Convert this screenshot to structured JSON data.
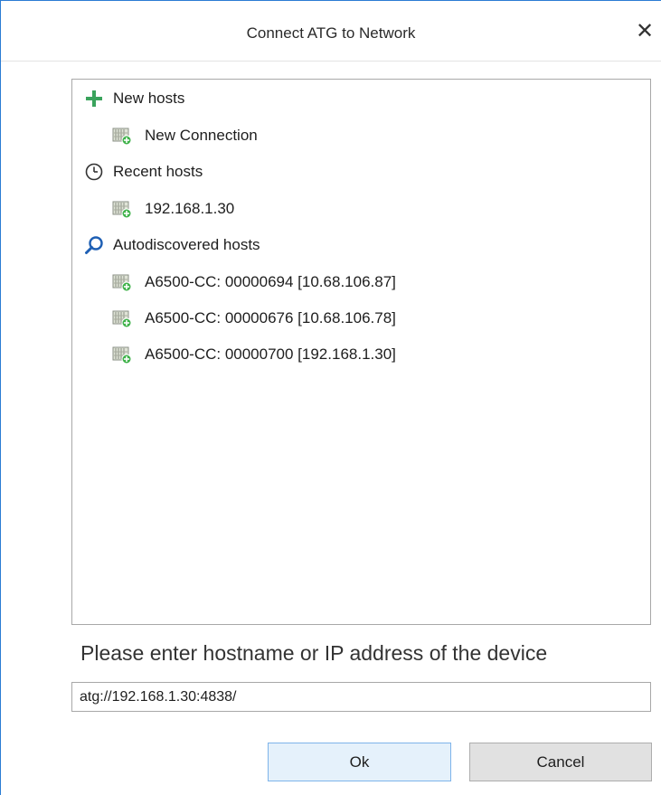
{
  "window": {
    "title": "Connect ATG to Network",
    "close_glyph": "✕"
  },
  "tree": {
    "groups": [
      {
        "label": "New hosts",
        "icon": "plus-icon",
        "items": [
          {
            "label": "New Connection",
            "icon": "device-icon"
          }
        ]
      },
      {
        "label": "Recent hosts",
        "icon": "clock-icon",
        "items": [
          {
            "label": "192.168.1.30",
            "icon": "device-icon"
          }
        ]
      },
      {
        "label": "Autodiscovered hosts",
        "icon": "search-icon",
        "items": [
          {
            "label": "A6500-CC: 00000694 [10.68.106.87]",
            "icon": "device-icon"
          },
          {
            "label": "A6500-CC: 00000676 [10.68.106.78]",
            "icon": "device-icon"
          },
          {
            "label": "A6500-CC: 00000700 [192.168.1.30]",
            "icon": "device-icon"
          }
        ]
      }
    ]
  },
  "prompt": "Please enter hostname or IP address of the device",
  "host_input": {
    "value": "atg://192.168.1.30:4838/"
  },
  "buttons": {
    "ok": "Ok",
    "cancel": "Cancel"
  },
  "colors": {
    "accent_border": "#2b7cd3",
    "plus_green": "#3aa35c",
    "search_blue": "#1e5fb4",
    "device_green": "#3fb24a",
    "ok_bg": "#e5f1fb",
    "ok_border": "#7eb4ea"
  }
}
